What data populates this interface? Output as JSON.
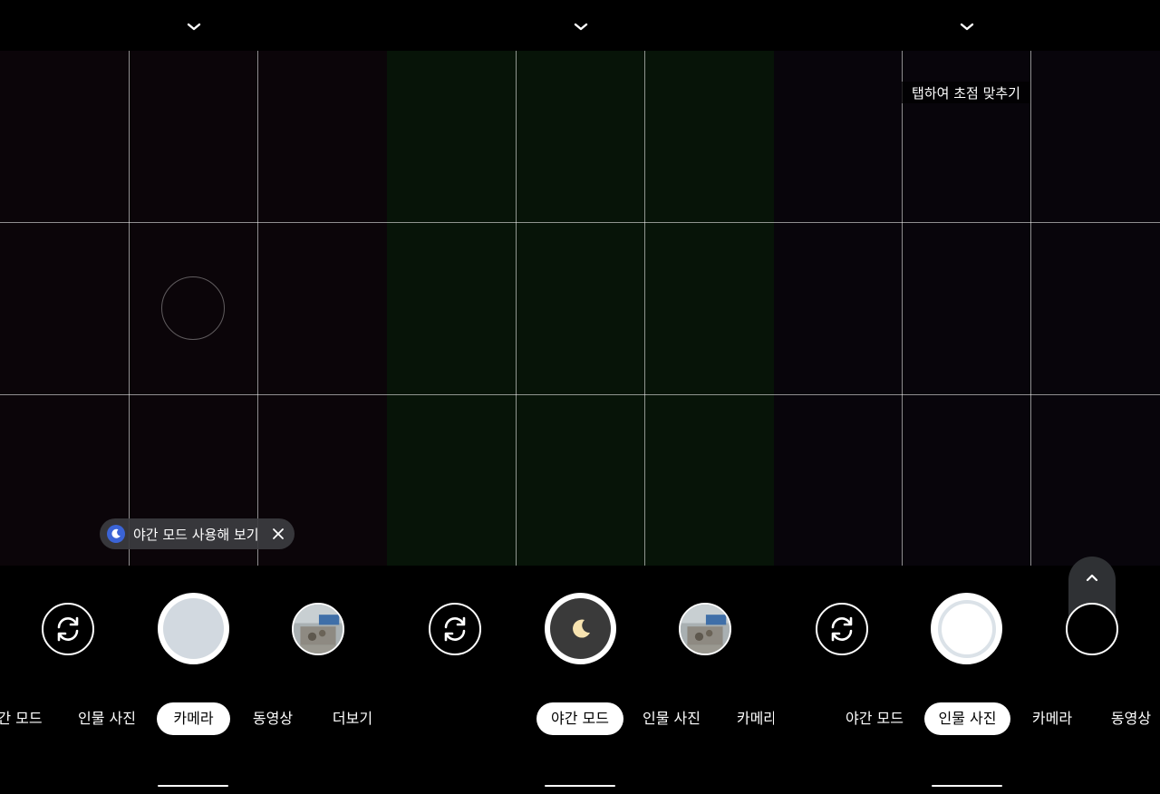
{
  "panels": [
    {
      "id": "camera",
      "chip": {
        "text": "야간 모드 사용해 보기"
      },
      "modes": [
        "간 모드",
        "인물 사진",
        "카메라",
        "동영상",
        "더보기"
      ],
      "active_mode": "카메라"
    },
    {
      "id": "night",
      "modes": [
        "야간 모드",
        "인물 사진",
        "카메라"
      ],
      "active_mode": "야간 모드"
    },
    {
      "id": "portrait",
      "tap_hint": "탭하여 초점 맞추기",
      "modes": [
        "야간 모드",
        "인물 사진",
        "카메라",
        "동영상"
      ],
      "active_mode": "인물 사진"
    }
  ],
  "icons": {
    "top_chevron": "chevron-down-icon",
    "flip": "switch-camera-icon",
    "night_shutter": "moon-icon",
    "chip_badge": "moon-icon",
    "chip_close": "close-icon",
    "expand": "chevron-up-icon"
  },
  "colors": {
    "viewfinder_camera": "#0b0509",
    "viewfinder_night": "#071408",
    "viewfinder_portrait": "#08050b",
    "chip_background": "#3c3c40",
    "moon_badge": "#3b64d6",
    "shutter_camera_fill": "#d2d9e0",
    "moon_fill": "#f7e3b0"
  }
}
